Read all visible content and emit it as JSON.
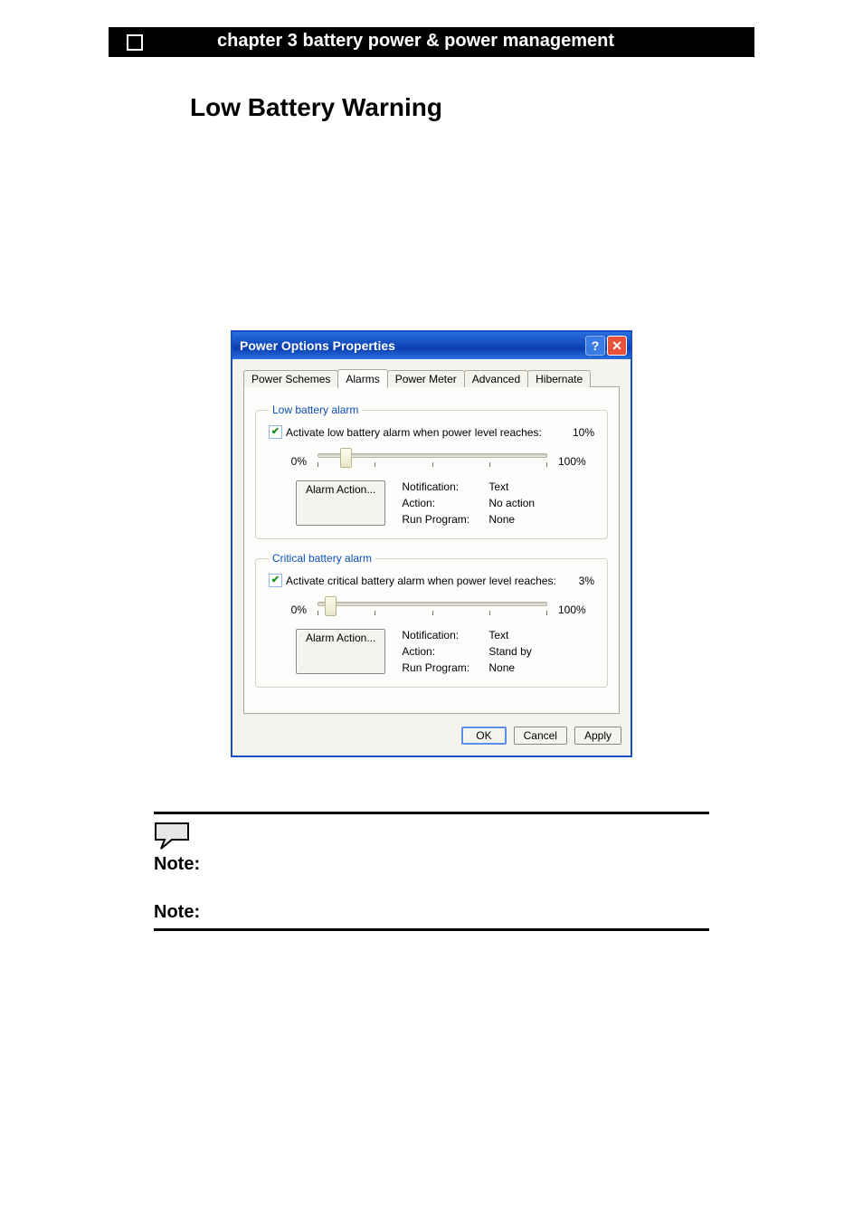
{
  "page_header": "chapter 3 battery power & power management",
  "section_title": "Low Battery Warning",
  "dialog": {
    "title": "Power Options Properties",
    "tabs": [
      "Power Schemes",
      "Alarms",
      "Power Meter",
      "Advanced",
      "Hibernate"
    ],
    "active_tab_index": 1,
    "low_alarm": {
      "legend": "Low battery alarm",
      "checkbox_label": "Activate low battery alarm when power level reaches:",
      "checked": true,
      "percent_value": "10%",
      "slider_min_label": "0%",
      "slider_max_label": "100%",
      "slider_position_pct": 10,
      "button_label": "Alarm Action...",
      "kv": {
        "notification_label": "Notification:",
        "notification_value": "Text",
        "action_label": "Action:",
        "action_value": "No action",
        "run_label": "Run Program:",
        "run_value": "None"
      }
    },
    "critical_alarm": {
      "legend": "Critical battery alarm",
      "checkbox_label": "Activate critical battery alarm when power level reaches:",
      "checked": true,
      "percent_value": "3%",
      "slider_min_label": "0%",
      "slider_max_label": "100%",
      "slider_position_pct": 3,
      "button_label": "Alarm Action...",
      "kv": {
        "notification_label": "Notification:",
        "notification_value": "Text",
        "action_label": "Action:",
        "action_value": "Stand by",
        "run_label": "Run Program:",
        "run_value": "None"
      }
    },
    "footer": {
      "ok": "OK",
      "cancel": "Cancel",
      "apply": "Apply"
    }
  },
  "notes": {
    "label": "Note:"
  }
}
